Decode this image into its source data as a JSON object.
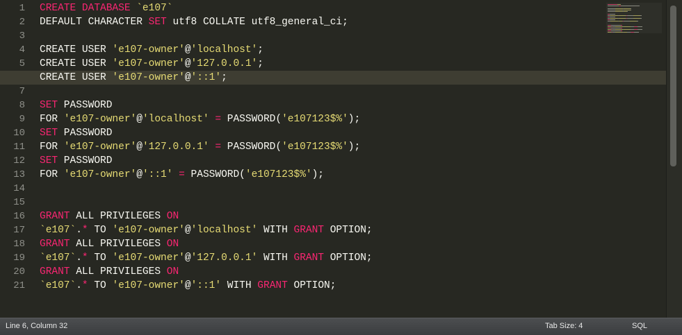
{
  "editor": {
    "line_numbers": [
      "1",
      "2",
      "3",
      "4",
      "5",
      "6",
      "7",
      "8",
      "9",
      "10",
      "11",
      "12",
      "13",
      "14",
      "15",
      "16",
      "17",
      "18",
      "19",
      "20",
      "21"
    ],
    "active_line": 6,
    "lines": [
      [
        {
          "t": "CREATE DATABASE ",
          "c": "kw"
        },
        {
          "t": "`e107`",
          "c": "str"
        }
      ],
      [
        {
          "t": "DEFAULT CHARACTER ",
          "c": "plain"
        },
        {
          "t": "SET",
          "c": "kw"
        },
        {
          "t": " utf8 COLLATE utf8_general_ci;",
          "c": "plain"
        }
      ],
      [],
      [
        {
          "t": "CREATE USER ",
          "c": "plain"
        },
        {
          "t": "'e107-owner'",
          "c": "str"
        },
        {
          "t": "@",
          "c": "plain"
        },
        {
          "t": "'localhost'",
          "c": "str"
        },
        {
          "t": ";",
          "c": "plain"
        }
      ],
      [
        {
          "t": "CREATE USER ",
          "c": "plain"
        },
        {
          "t": "'e107-owner'",
          "c": "str"
        },
        {
          "t": "@",
          "c": "plain"
        },
        {
          "t": "'127.0.0.1'",
          "c": "str"
        },
        {
          "t": ";",
          "c": "plain"
        }
      ],
      [
        {
          "t": "CREATE USER ",
          "c": "plain"
        },
        {
          "t": "'e107-owner'",
          "c": "str"
        },
        {
          "t": "@",
          "c": "plain"
        },
        {
          "t": "'::1'",
          "c": "str"
        },
        {
          "t": ";",
          "c": "plain"
        }
      ],
      [],
      [
        {
          "t": "SET",
          "c": "kw"
        },
        {
          "t": " PASSWORD",
          "c": "plain"
        }
      ],
      [
        {
          "t": "FOR ",
          "c": "plain"
        },
        {
          "t": "'e107-owner'",
          "c": "str"
        },
        {
          "t": "@",
          "c": "plain"
        },
        {
          "t": "'localhost'",
          "c": "str"
        },
        {
          "t": " ",
          "c": "plain"
        },
        {
          "t": "=",
          "c": "kw"
        },
        {
          "t": " PASSWORD(",
          "c": "plain"
        },
        {
          "t": "'e107123$%'",
          "c": "str"
        },
        {
          "t": ");",
          "c": "plain"
        }
      ],
      [
        {
          "t": "SET",
          "c": "kw"
        },
        {
          "t": " PASSWORD",
          "c": "plain"
        }
      ],
      [
        {
          "t": "FOR ",
          "c": "plain"
        },
        {
          "t": "'e107-owner'",
          "c": "str"
        },
        {
          "t": "@",
          "c": "plain"
        },
        {
          "t": "'127.0.0.1'",
          "c": "str"
        },
        {
          "t": " ",
          "c": "plain"
        },
        {
          "t": "=",
          "c": "kw"
        },
        {
          "t": " PASSWORD(",
          "c": "plain"
        },
        {
          "t": "'e107123$%'",
          "c": "str"
        },
        {
          "t": ");",
          "c": "plain"
        }
      ],
      [
        {
          "t": "SET",
          "c": "kw"
        },
        {
          "t": " PASSWORD",
          "c": "plain"
        }
      ],
      [
        {
          "t": "FOR ",
          "c": "plain"
        },
        {
          "t": "'e107-owner'",
          "c": "str"
        },
        {
          "t": "@",
          "c": "plain"
        },
        {
          "t": "'::1'",
          "c": "str"
        },
        {
          "t": " ",
          "c": "plain"
        },
        {
          "t": "=",
          "c": "kw"
        },
        {
          "t": " PASSWORD(",
          "c": "plain"
        },
        {
          "t": "'e107123$%'",
          "c": "str"
        },
        {
          "t": ");",
          "c": "plain"
        }
      ],
      [],
      [],
      [
        {
          "t": "GRANT",
          "c": "kw"
        },
        {
          "t": " ALL PRIVILEGES ",
          "c": "plain"
        },
        {
          "t": "ON",
          "c": "kw"
        }
      ],
      [
        {
          "t": "`e107`",
          "c": "str"
        },
        {
          "t": ".",
          "c": "plain"
        },
        {
          "t": "*",
          "c": "kw"
        },
        {
          "t": " TO ",
          "c": "plain"
        },
        {
          "t": "'e107-owner'",
          "c": "str"
        },
        {
          "t": "@",
          "c": "plain"
        },
        {
          "t": "'localhost'",
          "c": "str"
        },
        {
          "t": " WITH ",
          "c": "plain"
        },
        {
          "t": "GRANT",
          "c": "kw"
        },
        {
          "t": " OPTION;",
          "c": "plain"
        }
      ],
      [
        {
          "t": "GRANT",
          "c": "kw"
        },
        {
          "t": " ALL PRIVILEGES ",
          "c": "plain"
        },
        {
          "t": "ON",
          "c": "kw"
        }
      ],
      [
        {
          "t": "`e107`",
          "c": "str"
        },
        {
          "t": ".",
          "c": "plain"
        },
        {
          "t": "*",
          "c": "kw"
        },
        {
          "t": " TO ",
          "c": "plain"
        },
        {
          "t": "'e107-owner'",
          "c": "str"
        },
        {
          "t": "@",
          "c": "plain"
        },
        {
          "t": "'127.0.0.1'",
          "c": "str"
        },
        {
          "t": " WITH ",
          "c": "plain"
        },
        {
          "t": "GRANT",
          "c": "kw"
        },
        {
          "t": " OPTION;",
          "c": "plain"
        }
      ],
      [
        {
          "t": "GRANT",
          "c": "kw"
        },
        {
          "t": " ALL PRIVILEGES ",
          "c": "plain"
        },
        {
          "t": "ON",
          "c": "kw"
        }
      ],
      [
        {
          "t": "`e107`",
          "c": "str"
        },
        {
          "t": ".",
          "c": "plain"
        },
        {
          "t": "*",
          "c": "kw"
        },
        {
          "t": " TO ",
          "c": "plain"
        },
        {
          "t": "'e107-owner'",
          "c": "str"
        },
        {
          "t": "@",
          "c": "plain"
        },
        {
          "t": "'::1'",
          "c": "str"
        },
        {
          "t": " WITH ",
          "c": "plain"
        },
        {
          "t": "GRANT",
          "c": "kw"
        },
        {
          "t": " OPTION;",
          "c": "plain"
        }
      ]
    ]
  },
  "status_bar": {
    "position": "Line 6, Column 32",
    "tab_size": "Tab Size: 4",
    "syntax": "SQL"
  },
  "colors": {
    "background": "#272822",
    "keyword": "#f92672",
    "string": "#e6db74",
    "text": "#f8f8f2"
  }
}
